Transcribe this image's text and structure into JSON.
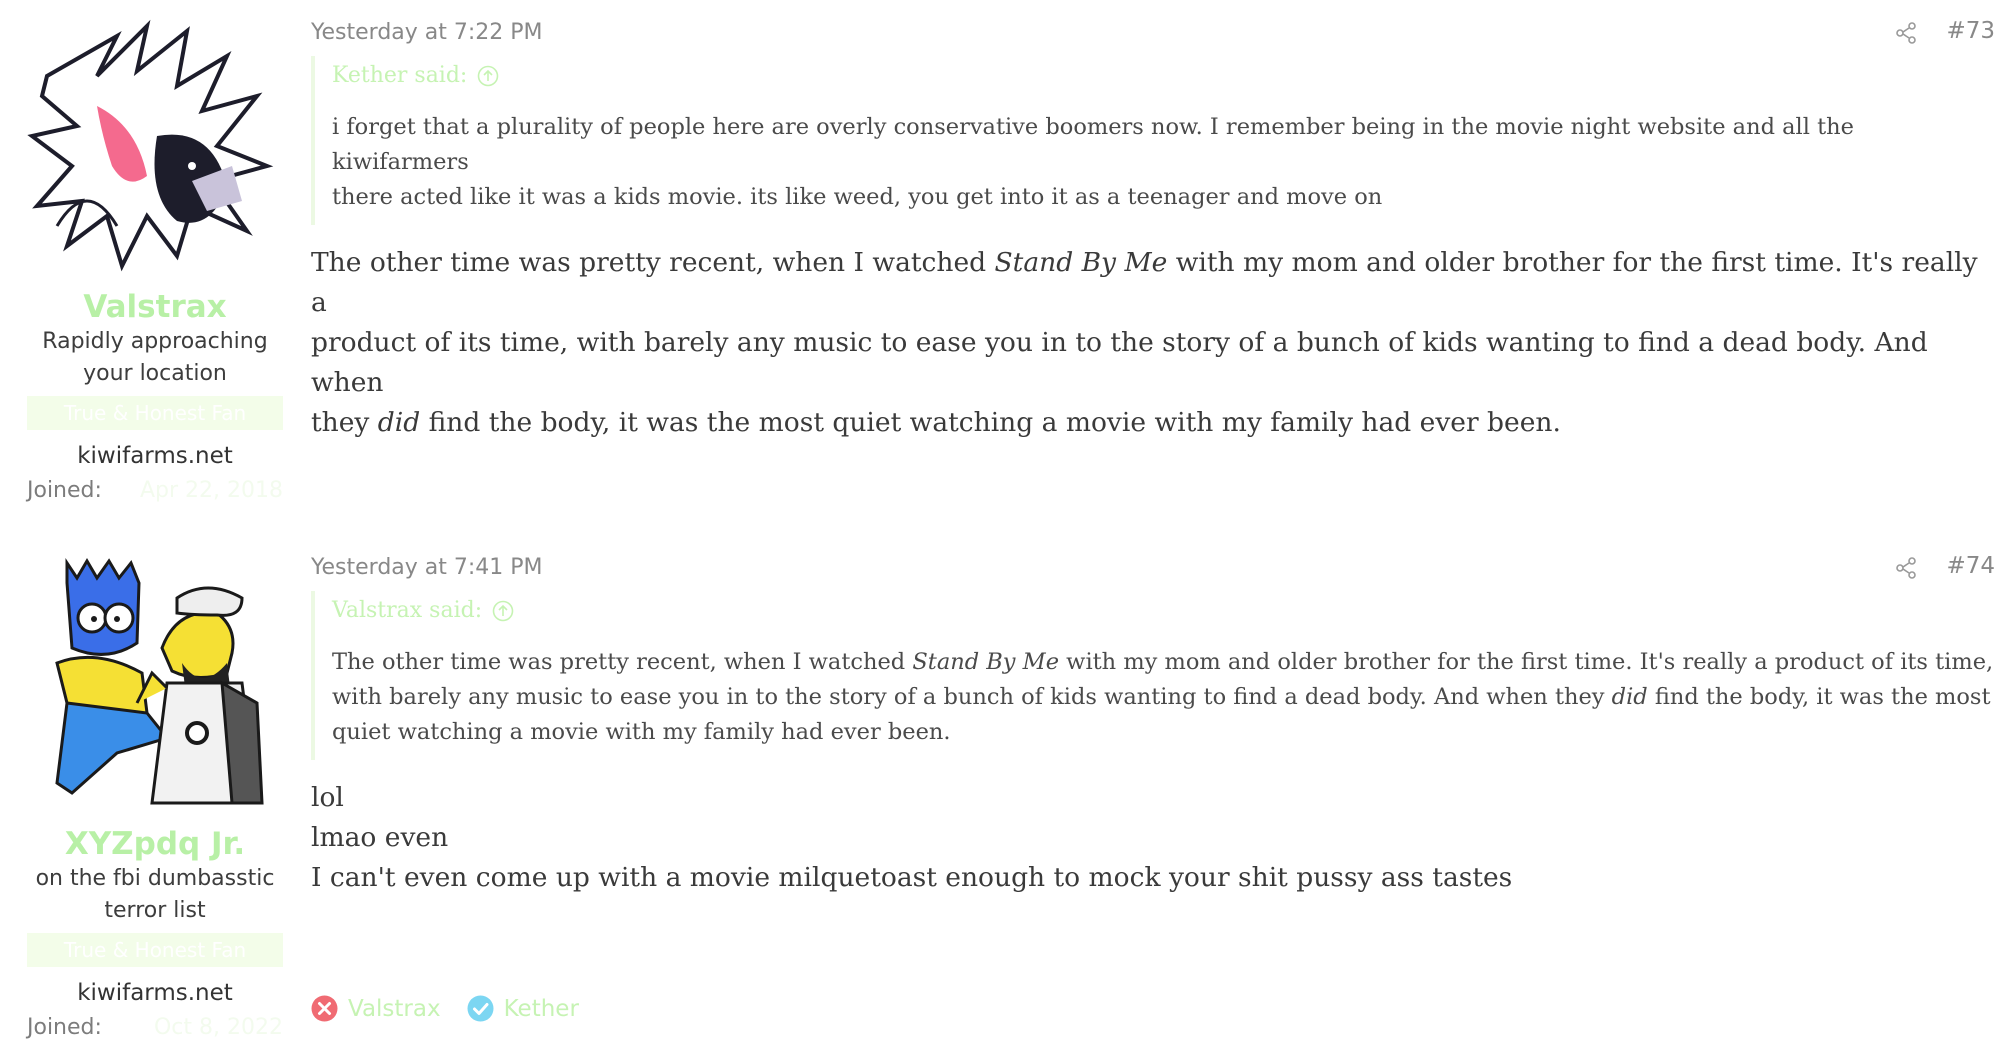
{
  "colors": {
    "username": "#b8f0a6",
    "quote_border": "#ecf9e3",
    "quote_attr": "#c6f3b3",
    "reaction_negative": "#f06b73",
    "reaction_positive": "#7cd6f2"
  },
  "posts": [
    {
      "user": {
        "name": "Valstrax",
        "title_line1": "Rapidly approaching",
        "title_line2": "your location",
        "banner": "True & Honest Fan",
        "site": "kiwifarms.net",
        "joined_label": "Joined:",
        "joined_value": "Apr 22, 2018",
        "avatar_icon": "valstrax-avatar"
      },
      "date": "Yesterday at 7:22 PM",
      "number": "#73",
      "quote": {
        "author": "Kether said:",
        "line1": "i forget that a plurality of people here are overly conservative boomers now. I remember being in the movie night website and all the kiwifarmers",
        "line2": "there acted like it was a kids movie. its like weed, you get into it as a teenager and move on"
      },
      "body": {
        "l1_pre": "The other time was pretty recent, when I watched ",
        "l1_em": "Stand By Me",
        "l1_post": " with my mom and older brother for the first time. It's really a",
        "l2": "product of its time, with barely any music to ease you in to the story of a bunch of kids wanting to find a dead body. And when",
        "l3_pre": "they ",
        "l3_em": "did",
        "l3_post": " find the body, it was the most quiet watching a movie with my family had ever been."
      }
    },
    {
      "user": {
        "name": "XYZpdq Jr.",
        "title_line1": "on the fbi dumbasstic",
        "title_line2": "terror list",
        "banner": "True & Honest Fan",
        "site": "kiwifarms.net",
        "joined_label": "Joined:",
        "joined_value": "Oct 8, 2022",
        "avatar_icon": "cartoon-avatar"
      },
      "date": "Yesterday at 7:41 PM",
      "number": "#74",
      "quote": {
        "author": "Valstrax said:",
        "l1_pre": "The other time was pretty recent, when I watched ",
        "l1_em": "Stand By Me",
        "l1_post": " with my mom and older brother for the first time. It's really a product of its time,",
        "l2_pre": "with barely any music to ease you in to the story of a bunch of kids wanting to find a dead body. And when they ",
        "l2_em": "did",
        "l2_post": " find the body, it was the most",
        "l3": "quiet watching a movie with my family had ever been."
      },
      "body": {
        "l1": "lol",
        "l2": "lmao even",
        "l3": "I can't even come up with a movie milquetoast enough to mock your shit pussy ass tastes"
      },
      "reactions": [
        {
          "icon": "x-circle-icon",
          "label": "Valstrax"
        },
        {
          "icon": "check-circle-icon",
          "label": "Kether"
        }
      ]
    }
  ]
}
